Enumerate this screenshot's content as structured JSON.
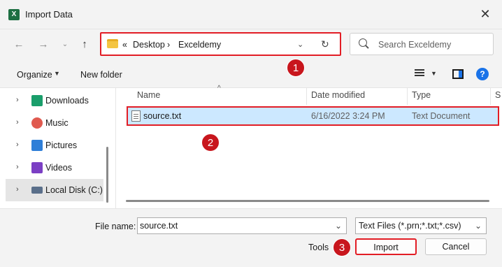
{
  "window": {
    "title": "Import Data",
    "app_icon": "X"
  },
  "address": {
    "sep": "«",
    "crumbs": [
      "Desktop",
      "Exceldemy"
    ]
  },
  "search": {
    "placeholder": "Search Exceldemy"
  },
  "toolbar": {
    "organize": "Organize",
    "new_folder": "New folder"
  },
  "sidebar": {
    "items": [
      {
        "label": "Downloads",
        "icon": "download-icon",
        "color": "#1a9e6b"
      },
      {
        "label": "Music",
        "icon": "music-icon",
        "color": "#e05a4f"
      },
      {
        "label": "Pictures",
        "icon": "pictures-icon",
        "color": "#2f7fd8"
      },
      {
        "label": "Videos",
        "icon": "videos-icon",
        "color": "#7b3fc4"
      },
      {
        "label": "Local Disk (C:)",
        "icon": "drive-icon",
        "color": "#5a6f8a"
      }
    ]
  },
  "filelist": {
    "columns": [
      "Name",
      "Date modified",
      "Type",
      "S"
    ],
    "rows": [
      {
        "name": "source.txt",
        "date": "6/16/2022 3:24 PM",
        "type": "Text Document"
      }
    ]
  },
  "footer": {
    "file_name_label": "File name:",
    "file_name_value": "source.txt",
    "file_type_value": "Text Files (*.prn;*.txt;*.csv)",
    "tools": "Tools",
    "import": "Import",
    "cancel": "Cancel"
  },
  "badges": [
    "1",
    "2",
    "3"
  ],
  "colors": {
    "highlight": "#e21d25",
    "selection": "#cce8ff",
    "badge": "#c8161d"
  }
}
